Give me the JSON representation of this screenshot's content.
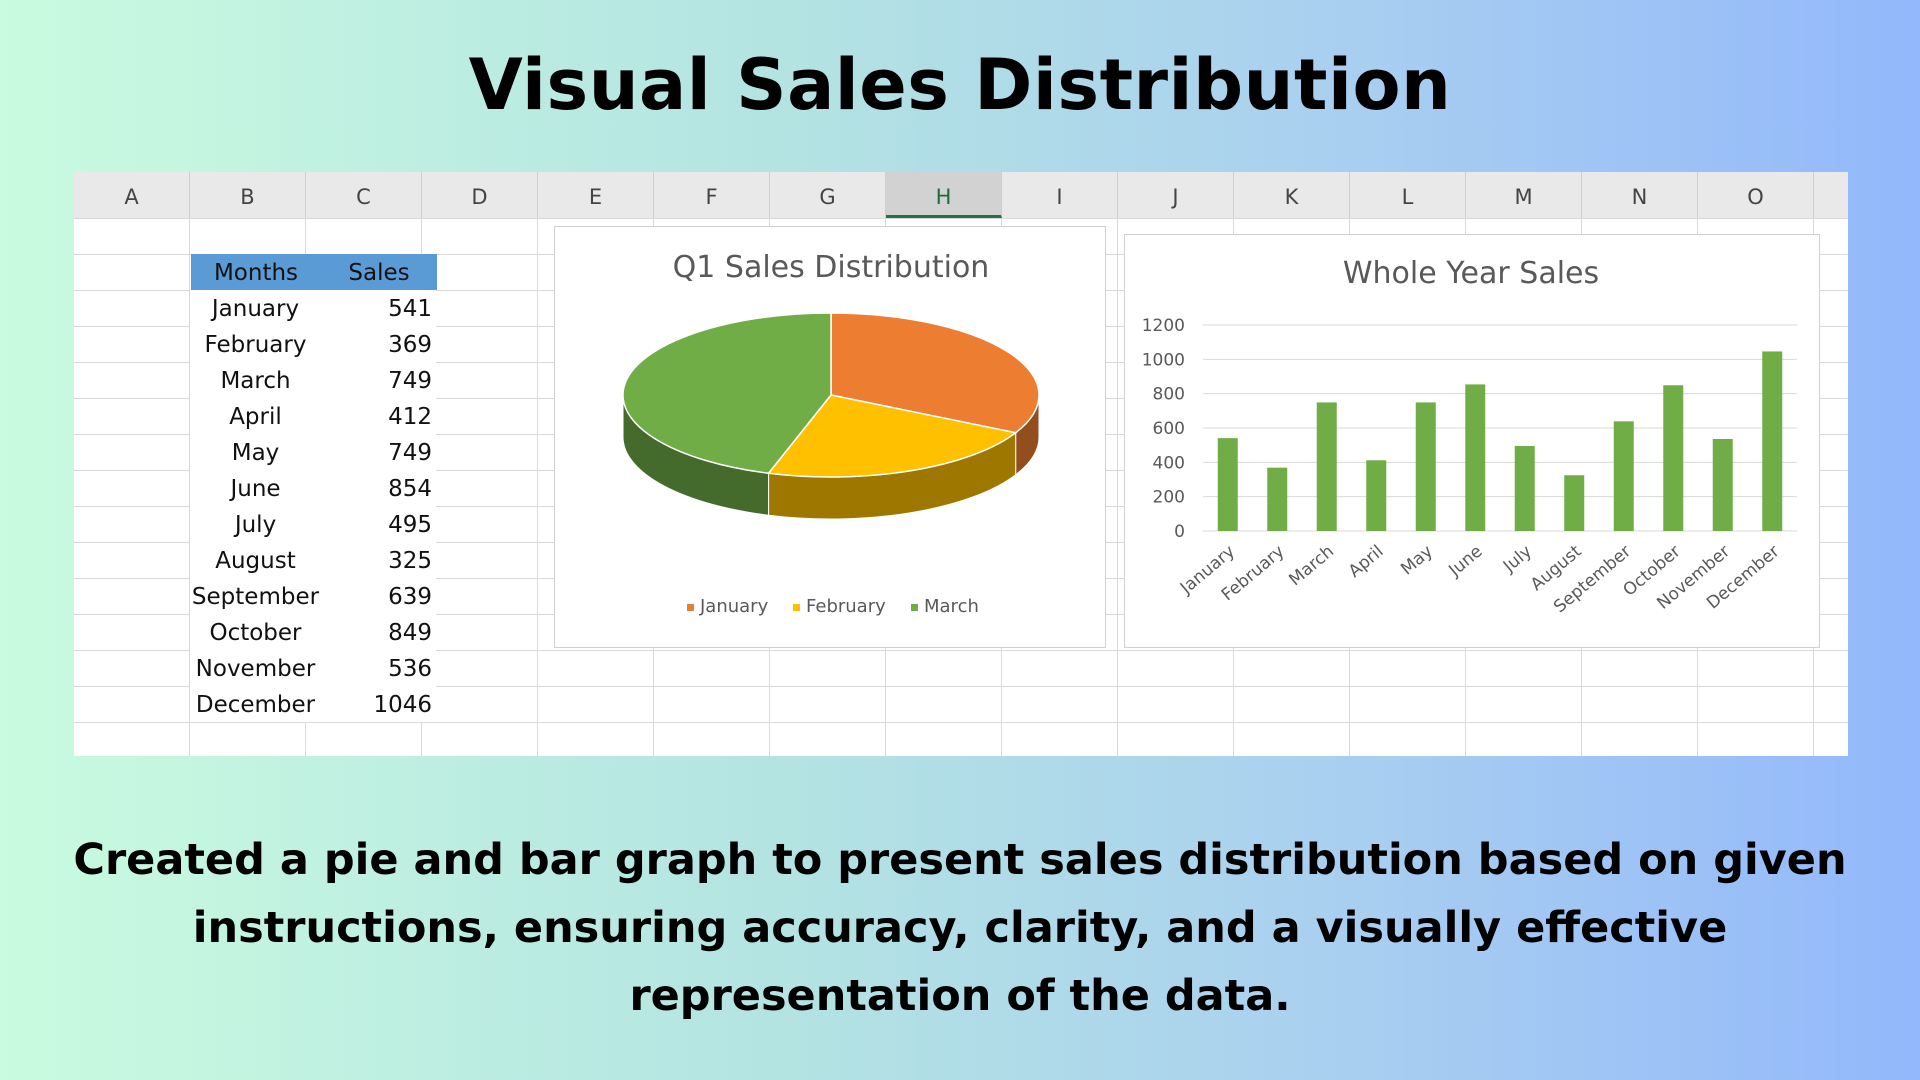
{
  "page": {
    "title": "Visual Sales Distribution",
    "description": "Created a pie and bar graph to present sales distribution based on given instructions, ensuring accuracy, clarity, and a visually effective representation of the data."
  },
  "spreadsheet": {
    "columns": [
      "A",
      "B",
      "C",
      "D",
      "E",
      "F",
      "G",
      "H",
      "I",
      "J",
      "K",
      "L",
      "M",
      "N",
      "O"
    ],
    "selected_column": "H",
    "table": {
      "headers": [
        "Months",
        "Sales"
      ],
      "rows": [
        [
          "January",
          "541"
        ],
        [
          "February",
          "369"
        ],
        [
          "March",
          "749"
        ],
        [
          "April",
          "412"
        ],
        [
          "May",
          "749"
        ],
        [
          "June",
          "854"
        ],
        [
          "July",
          "495"
        ],
        [
          "August",
          "325"
        ],
        [
          "September",
          "639"
        ],
        [
          "October",
          "849"
        ],
        [
          "November",
          "536"
        ],
        [
          "December",
          "1046"
        ]
      ]
    }
  },
  "colors": {
    "table_header": "#5b9bd5",
    "pie": [
      "#ed7d31",
      "#ffc000",
      "#70ad47"
    ],
    "bar": "#70ad47"
  },
  "chart_data": [
    {
      "type": "pie",
      "title": "Q1 Sales Distribution",
      "categories": [
        "January",
        "February",
        "March"
      ],
      "values": [
        541,
        369,
        749
      ],
      "legend": "bottom"
    },
    {
      "type": "bar",
      "title": "Whole Year Sales",
      "categories": [
        "January",
        "February",
        "March",
        "April",
        "May",
        "June",
        "July",
        "August",
        "September",
        "October",
        "November",
        "December"
      ],
      "values": [
        541,
        369,
        749,
        412,
        749,
        854,
        495,
        325,
        639,
        849,
        536,
        1046
      ],
      "ylim": [
        0,
        1200
      ],
      "yticks": [
        0,
        200,
        400,
        600,
        800,
        1000,
        1200
      ],
      "grid": true
    }
  ]
}
